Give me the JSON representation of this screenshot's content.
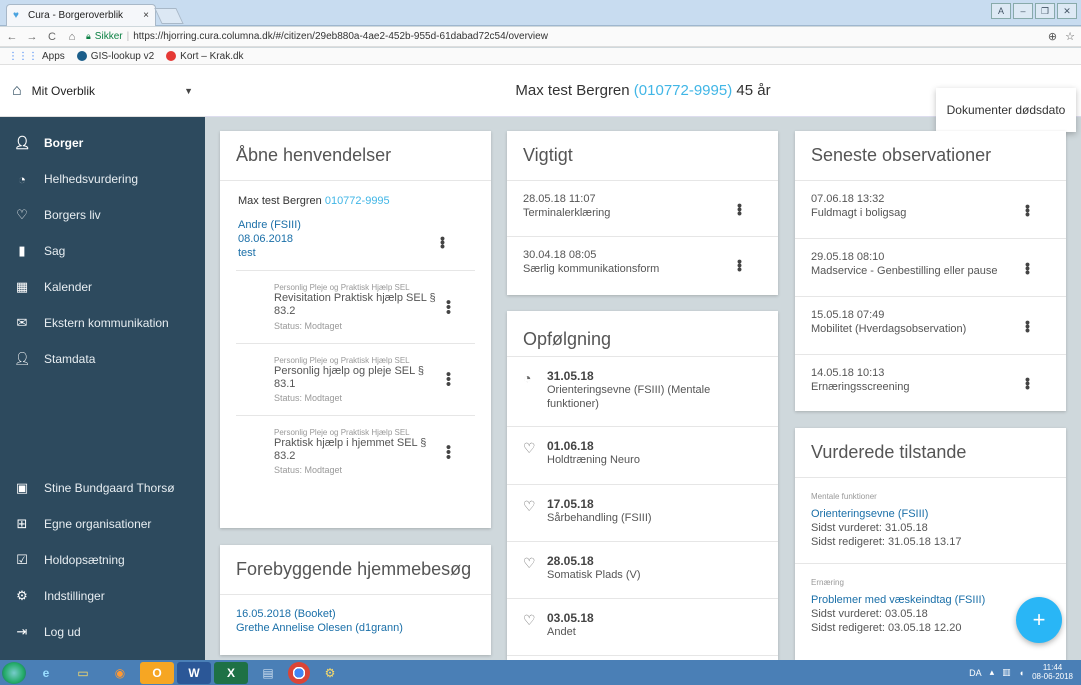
{
  "browser": {
    "tab_title": "Cura - Borgeroverblik",
    "tab_close": "×",
    "secure_label": "Sikker",
    "url": "https://hjorring.cura.columna.dk/#/citizen/29eb880a-4ae2-452b-955d-61dabad72c54/overview",
    "bookmarks": [
      {
        "label": "Apps"
      },
      {
        "label": "GIS-lookup v2"
      },
      {
        "label": "Kort – Krak.dk"
      }
    ]
  },
  "sidebar": {
    "top_label": "Mit Overblik",
    "items": [
      {
        "label": "Borger",
        "icon": "person-icon"
      },
      {
        "label": "Helhedsvurdering",
        "icon": "circle-arrows-icon"
      },
      {
        "label": "Borgers liv",
        "icon": "heart-icon"
      },
      {
        "label": "Sag",
        "icon": "folder-icon"
      },
      {
        "label": "Kalender",
        "icon": "calendar-icon"
      },
      {
        "label": "Ekstern kommunikation",
        "icon": "mail-icon"
      },
      {
        "label": "Stamdata",
        "icon": "person-settings-icon"
      }
    ],
    "bottom_items": [
      {
        "label": "Stine Bundgaard Thorsø",
        "icon": "id-card-icon"
      },
      {
        "label": "Egne organisationer",
        "icon": "org-chart-icon"
      },
      {
        "label": "Holdopsætning",
        "icon": "team-calendar-icon"
      },
      {
        "label": "Indstillinger",
        "icon": "gear-icon"
      },
      {
        "label": "Log ud",
        "icon": "logout-icon"
      }
    ]
  },
  "header": {
    "name": "Max test Bergren",
    "cpr": "(010772-9995)",
    "age": "45 år",
    "doddato_label": "Dokumenter dødsdato"
  },
  "aabne": {
    "title": "Åbne henvendelser",
    "citizen_name": "Max test Bergren",
    "citizen_cpr": "010772-9995",
    "first_line": "Andre (FSIII)",
    "first_date": "08.06.2018",
    "first_text": "test",
    "subs": [
      {
        "small": "Personlig Pleje og Praktisk Hjælp SEL",
        "main": "Revisitation Praktisk hjælp SEL § 83.2",
        "status": "Status: Modtaget"
      },
      {
        "small": "Personlig Pleje og Praktisk Hjælp SEL",
        "main": "Personlig hjælp og pleje SEL § 83.1",
        "status": "Status: Modtaget"
      },
      {
        "small": "Personlig Pleje og Praktisk Hjælp SEL",
        "main": "Praktisk hjælp i hjemmet SEL § 83.2",
        "status": "Status: Modtaget"
      }
    ]
  },
  "forebyg": {
    "title": "Forebyggende hjemmebesøg",
    "line1": "16.05.2018 (Booket)",
    "line2": "Grethe Annelise Olesen (d1grann)"
  },
  "vigtigt": {
    "title": "Vigtigt",
    "rows": [
      {
        "date": "28.05.18 11:07",
        "text": "Terminalerklæring"
      },
      {
        "date": "30.04.18 08:05",
        "text": "Særlig kommunikationsform"
      }
    ]
  },
  "opfolgning": {
    "title": "Opfølgning",
    "rows": [
      {
        "date": "31.05.18",
        "text": "Orienteringsevne (FSIII) (Mentale funktioner)",
        "icon": "circle-arrows-icon"
      },
      {
        "date": "01.06.18",
        "text": "Holdtræning Neuro",
        "icon": "heart-icon"
      },
      {
        "date": "17.05.18",
        "text": "Sårbehandling (FSIII)",
        "icon": "heart-icon"
      },
      {
        "date": "28.05.18",
        "text": "Somatisk Plads (V)",
        "icon": "heart-icon"
      },
      {
        "date": "03.05.18",
        "text": "Andet",
        "icon": "heart-icon"
      }
    ]
  },
  "observationer": {
    "title": "Seneste observationer",
    "rows": [
      {
        "date": "07.06.18 13:32",
        "text": "Fuldmagt i boligsag"
      },
      {
        "date": "29.05.18 08:10",
        "text": "Madservice - Genbestilling eller pause"
      },
      {
        "date": "15.05.18 07:49",
        "text": "Mobilitet (Hverdagsobservation)"
      },
      {
        "date": "14.05.18 10:13",
        "text": "Ernæringsscreening"
      }
    ]
  },
  "tilstande": {
    "title": "Vurderede tilstande",
    "rows": [
      {
        "tag": "Mentale funktioner",
        "name": "Orienteringsevne (FSIII)",
        "vurderet": "Sidst vurderet: 31.05.18",
        "redigeret": "Sidst redigeret: 31.05.18 13.17"
      },
      {
        "tag": "Ernæring",
        "name": "Problemer med væskeindtag (FSIII)",
        "vurderet": "Sidst vurderet: 03.05.18",
        "redigeret": "Sidst redigeret: 03.05.18 12.20"
      }
    ]
  },
  "fab_label": "+",
  "taskbar": {
    "lang": "DA",
    "time": "11:44",
    "date": "08-06-2018"
  }
}
